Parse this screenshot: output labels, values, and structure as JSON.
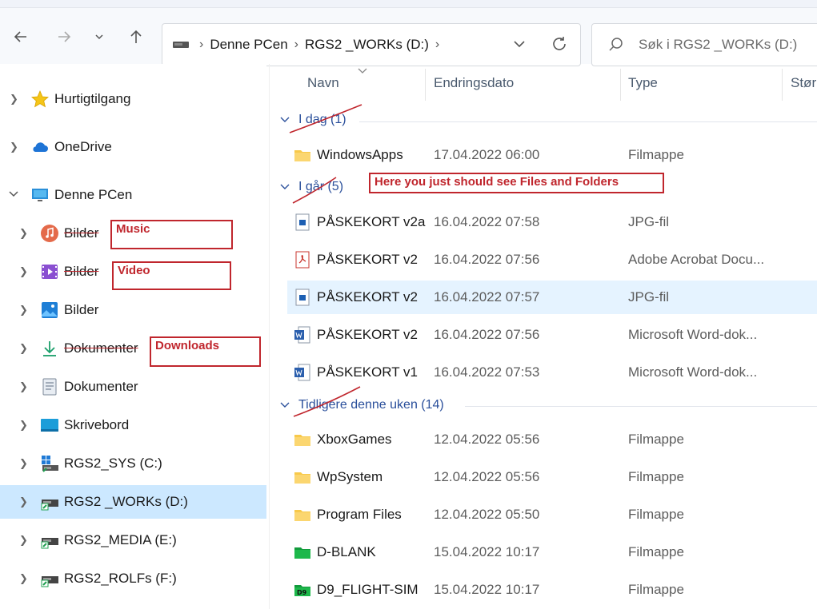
{
  "address": {
    "crumbs": [
      "Denne PCen",
      "RGS2 _WORKs (D:)"
    ]
  },
  "search": {
    "placeholder": "Søk i RGS2 _WORKs (D:)"
  },
  "sidebar": {
    "items": [
      {
        "label": "Hurtigtilgang",
        "icon": "star-icon"
      },
      {
        "label": "OneDrive",
        "icon": "cloud-icon"
      },
      {
        "label": "Denne PCen",
        "icon": "monitor-icon"
      },
      {
        "label": "Bilder",
        "icon": "music-icon"
      },
      {
        "label": "Bilder",
        "icon": "video-icon"
      },
      {
        "label": "Bilder",
        "icon": "pictures-icon"
      },
      {
        "label": "Dokumenter",
        "icon": "download-icon"
      },
      {
        "label": "Dokumenter",
        "icon": "documents-icon"
      },
      {
        "label": "Skrivebord",
        "icon": "desktop-icon"
      },
      {
        "label": "RGS2_SYS (C:)",
        "icon": "drive-icon"
      },
      {
        "label": "RGS2 _WORKs (D:)",
        "icon": "drive-icon"
      },
      {
        "label": "RGS2_MEDIA (E:)",
        "icon": "drive-icon"
      },
      {
        "label": "RGS2_ROLFs (F:)",
        "icon": "drive-icon"
      }
    ]
  },
  "columns": {
    "name": "Navn",
    "date": "Endringsdato",
    "type": "Type",
    "size": "Stør"
  },
  "groups": [
    {
      "label": "I dag",
      "count": "(1)"
    },
    {
      "label": "I går",
      "count": "(5)"
    },
    {
      "label": "Tidligere denne uken",
      "count": "(14)"
    }
  ],
  "files": [
    {
      "name": "WindowsApps",
      "date": "17.04.2022 06:00",
      "type": "Filmappe",
      "icon": "folder-icon"
    },
    {
      "name": "PÅSKEKORT v2a",
      "date": "16.04.2022 07:58",
      "type": "JPG-fil",
      "icon": "image-file-icon"
    },
    {
      "name": "PÅSKEKORT v2",
      "date": "16.04.2022 07:56",
      "type": "Adobe Acrobat Docu...",
      "icon": "pdf-icon"
    },
    {
      "name": "PÅSKEKORT v2",
      "date": "16.04.2022 07:57",
      "type": "JPG-fil",
      "icon": "image-file-icon"
    },
    {
      "name": "PÅSKEKORT v2",
      "date": "16.04.2022 07:56",
      "type": "Microsoft Word-dok...",
      "icon": "word-icon"
    },
    {
      "name": "PÅSKEKORT v1",
      "date": "16.04.2022 07:53",
      "type": "Microsoft Word-dok...",
      "icon": "word-icon"
    },
    {
      "name": "XboxGames",
      "date": "12.04.2022 05:56",
      "type": "Filmappe",
      "icon": "folder-icon"
    },
    {
      "name": "WpSystem",
      "date": "12.04.2022 05:56",
      "type": "Filmappe",
      "icon": "folder-icon"
    },
    {
      "name": "Program Files",
      "date": "12.04.2022 05:50",
      "type": "Filmappe",
      "icon": "folder-icon"
    },
    {
      "name": "D-BLANK",
      "date": "15.04.2022 10:17",
      "type": "Filmappe",
      "icon": "green-folder-icon"
    },
    {
      "name": "D9_FLIGHT-SIM",
      "date": "15.04.2022 10:17",
      "type": "Filmappe",
      "icon": "d9-folder-icon"
    }
  ],
  "annotations": {
    "music": "Music",
    "video": "Video",
    "downloads": "Downloads",
    "note": "Here you just should see Files and Folders"
  },
  "colors": {
    "selection": "#cce8ff",
    "row_selection": "#e5f3ff",
    "annotation": "#c0262d",
    "group": "#2a4f9b"
  }
}
